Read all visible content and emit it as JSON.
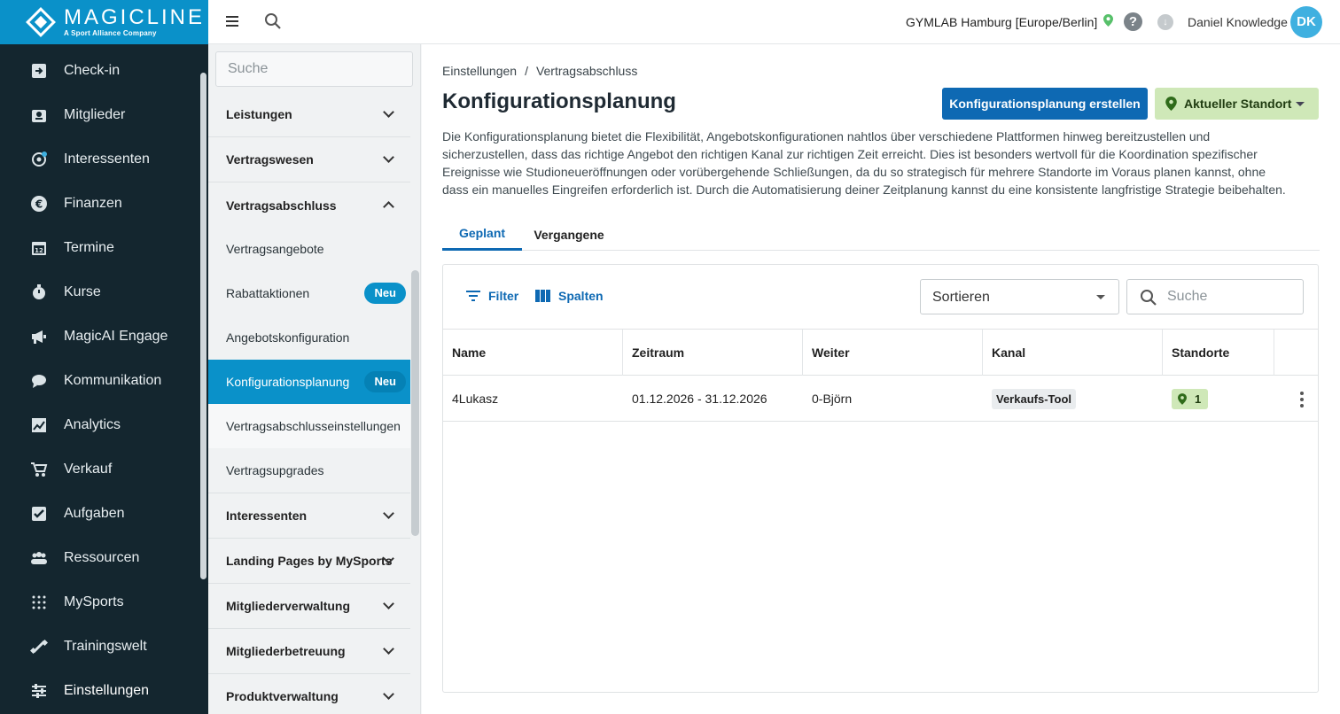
{
  "brand": {
    "name": "MAGICLINE",
    "tagline": "A Sport Alliance Company"
  },
  "nav": {
    "items": [
      {
        "label": "Check-in",
        "icon": "check-in-icon"
      },
      {
        "label": "Mitglieder",
        "icon": "members-icon"
      },
      {
        "label": "Interessenten",
        "icon": "prospects-icon"
      },
      {
        "label": "Finanzen",
        "icon": "euro-icon"
      },
      {
        "label": "Termine",
        "icon": "calendar-icon"
      },
      {
        "label": "Kurse",
        "icon": "timer-icon"
      },
      {
        "label": "MagicAI Engage",
        "icon": "megaphone-icon"
      },
      {
        "label": "Kommunikation",
        "icon": "chat-icon"
      },
      {
        "label": "Analytics",
        "icon": "chart-icon"
      },
      {
        "label": "Verkauf",
        "icon": "cart-icon"
      },
      {
        "label": "Aufgaben",
        "icon": "checkbox-icon"
      },
      {
        "label": "Ressourcen",
        "icon": "group-icon"
      },
      {
        "label": "MySports",
        "icon": "dots-grid-icon"
      },
      {
        "label": "Trainingswelt",
        "icon": "dumbbell-icon"
      },
      {
        "label": "Einstellungen",
        "icon": "sliders-icon"
      }
    ]
  },
  "topbar": {
    "location": "GYMLAB Hamburg [Europe/Berlin]",
    "help": "?",
    "user_name": "Daniel Knowledge",
    "avatar_initials": "DK"
  },
  "submenu": {
    "search_placeholder": "Suche",
    "sections": {
      "leistungen": "Leistungen",
      "vertragswesen": "Vertragswesen",
      "vertragsabschluss": "Vertragsabschluss",
      "interessenten": "Interessenten",
      "landing": "Landing Pages by MySports",
      "mitgliederverwaltung": "Mitgliederverwaltung",
      "mitgliederbetreuung": "Mitgliederbetreuung",
      "produktverwaltung": "Produktverwaltung"
    },
    "items": {
      "vertragsangebote": "Vertragsangebote",
      "rabattaktionen": "Rabattaktionen",
      "angebotskonfiguration": "Angebotskonfiguration",
      "konfigurationsplanung": "Konfigurationsplanung",
      "vertragsabschlusseinstellungen": "Vertragsabschlusseinstellungen",
      "vertragsupgrades": "Vertragsupgrades"
    },
    "badge_new": "Neu"
  },
  "main": {
    "breadcrumb": [
      "Einstellungen",
      "/",
      "Vertragsabschluss"
    ],
    "title": "Konfigurationsplanung",
    "create_button": "Konfigurationsplanung erstellen",
    "location_button": "Aktueller Standort",
    "description": "Die Konfigurationsplanung bietet die Flexibilität, Angebotskonfigurationen nahtlos über verschiedene Plattformen hinweg bereitzustellen und sicherzustellen, dass das richtige Angebot den richtigen Kanal zur richtigen Zeit erreicht. Dies ist besonders wertvoll für die Koordination spezifischer Ereignisse wie Studioneueröffnungen oder vorübergehende Schließungen, da du so strategisch für mehrere Standorte im Voraus planen kannst, ohne dass ein manuelles Eingreifen erforderlich ist. Durch die Automatisierung deiner Zeitplanung kannst du eine konsistente langfristige Strategie beibehalten.",
    "tabs": [
      "Geplant",
      "Vergangene"
    ],
    "toolbar": {
      "filter": "Filter",
      "columns": "Spalten",
      "sort_placeholder": "Sortieren",
      "search_placeholder": "Suche"
    },
    "table": {
      "columns": [
        "Name",
        "Zeitraum",
        "Weiter",
        "Kanal",
        "Standorte"
      ],
      "rows": [
        {
          "name": "4Lukasz",
          "period": "01.12.2026 - 31.12.2026",
          "next": "0-Björn",
          "channel": "Verkaufs-Tool",
          "locations": "1"
        }
      ]
    }
  }
}
